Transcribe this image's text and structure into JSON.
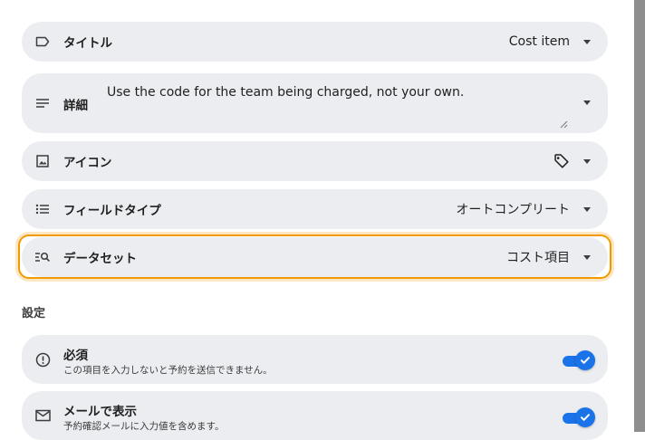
{
  "title_row": {
    "label": "タイトル",
    "value": "Cost item",
    "icon": "label-icon"
  },
  "detail_row": {
    "label": "詳細",
    "text": "Use the code for the team being charged, not your own.",
    "icon": "notes-icon"
  },
  "icon_row": {
    "label": "アイコン",
    "icon": "image-icon",
    "value_icon": "tag-icon"
  },
  "field_type_row": {
    "label": "フィールドタイプ",
    "value": "オートコンプリート",
    "icon": "list-icon"
  },
  "dataset_row": {
    "label": "データセット",
    "value": "コスト項目",
    "icon": "list-search-icon",
    "focused": true
  },
  "settings": {
    "heading": "設定",
    "required": {
      "label": "必須",
      "description": "この項目を入力しないと予約を送信できません。",
      "checked": true,
      "icon": "info-icon"
    },
    "show_in_email": {
      "label": "メールで表示",
      "description": "予約確認メールに入力値を含めます。",
      "checked": true,
      "icon": "mail-icon"
    }
  },
  "colors": {
    "accent": "#1a73e8",
    "focus": "#f29900",
    "pill_bg": "#ebedf0"
  }
}
